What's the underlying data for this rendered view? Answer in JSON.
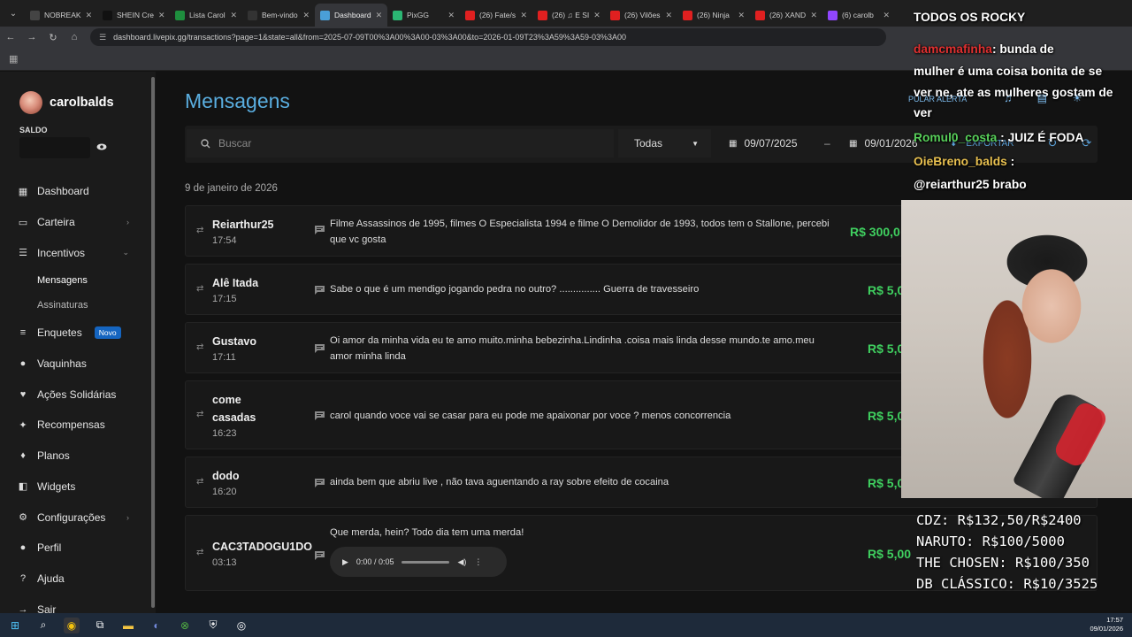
{
  "browser": {
    "tabs": [
      {
        "label": "NOBREAK",
        "color": "#444444"
      },
      {
        "label": "SHEIN Cre",
        "color": "#111111"
      },
      {
        "label": "Lista Carol",
        "color": "#1e8e3e"
      },
      {
        "label": "Bem-vindo",
        "color": "#333333"
      },
      {
        "label": "Dashboard",
        "color": "#4a9fd8",
        "active": true
      },
      {
        "label": "PixGG",
        "color": "#2bb673"
      },
      {
        "label": "(26) Fate/s",
        "color": "#e02020"
      },
      {
        "label": "(26) ♫ E SI",
        "color": "#e02020"
      },
      {
        "label": "(26) Vilões",
        "color": "#e02020"
      },
      {
        "label": "(26) Ninja",
        "color": "#e02020"
      },
      {
        "label": "(26) XAND",
        "color": "#e02020"
      },
      {
        "label": "(6) carolb",
        "color": "#9146ff"
      }
    ],
    "url": "dashboard.livepix.gg/transactions?page=1&state=all&from=2025-07-09T00%3A00%3A00-03%3A00&to=2026-01-09T23%3A59%3A59-03%3A00"
  },
  "sidebar": {
    "username": "carolbalds",
    "saldo_label": "SALDO",
    "items": [
      {
        "label": "Dashboard",
        "icon": "dashboard-icon",
        "glyph": "▦"
      },
      {
        "label": "Carteira",
        "icon": "wallet-icon",
        "glyph": "▭",
        "chevron": "›"
      },
      {
        "label": "Incentivos",
        "icon": "chat-icon",
        "glyph": "☰",
        "chevron": "⌄"
      },
      {
        "label": "Enquetes",
        "icon": "poll-icon",
        "glyph": "≡",
        "badge": "Novo"
      },
      {
        "label": "Vaquinhas",
        "icon": "piggy-icon",
        "glyph": "●"
      },
      {
        "label": "Ações Solidárias",
        "icon": "handshake-icon",
        "glyph": "♥"
      },
      {
        "label": "Recompensas",
        "icon": "gift-icon",
        "glyph": "✦"
      },
      {
        "label": "Planos",
        "icon": "plans-icon",
        "glyph": "♦"
      },
      {
        "label": "Widgets",
        "icon": "widgets-icon",
        "glyph": "◧"
      },
      {
        "label": "Configurações",
        "icon": "gear-icon",
        "glyph": "⚙",
        "chevron": "›"
      },
      {
        "label": "Perfil",
        "icon": "user-icon",
        "glyph": "●"
      },
      {
        "label": "Ajuda",
        "icon": "help-icon",
        "glyph": "?"
      },
      {
        "label": "Sair",
        "icon": "logout-icon",
        "glyph": "→"
      }
    ],
    "subitems": [
      "Mensagens",
      "Assinaturas"
    ]
  },
  "main": {
    "title": "Mensagens",
    "search_placeholder": "Buscar",
    "filter": "Todas",
    "date_from": "09/07/2025",
    "date_sep": "–",
    "date_to": "09/01/2026",
    "export_label": "EXPORTAR",
    "date_header": "9 de janeiro de 2026",
    "rows": [
      {
        "name": "Reiarthur25",
        "time": "17:54",
        "message": "Filme Assassinos de 1995, filmes O Especialista 1994 e filme O Demolidor de 1993, todos tem o Stallone, percebi que vc gosta",
        "amount": "R$ 300,0"
      },
      {
        "name": "Alê Itada",
        "time": "17:15",
        "message": "Sabe o que é um mendigo jogando pedra no outro? ............... Guerra de travesseiro",
        "amount": "R$ 5,0"
      },
      {
        "name": "Gustavo",
        "time": "17:11",
        "message": "Oi amor da minha vida eu te amo muito.minha bebezinha.Lindinha .coisa mais linda desse mundo.te amo.meu amor minha linda",
        "amount": "R$ 5,0"
      },
      {
        "name": "come casadas",
        "time": "16:23",
        "message": "carol quando voce vai se casar para eu pode me apaixonar por voce ? menos concorrencia",
        "amount": "R$ 5,0"
      },
      {
        "name": "dodo",
        "time": "16:20",
        "message": "ainda bem que abriu live , não tava aguentando a ray sobre efeito de cocaina",
        "amount": "R$ 5,0"
      },
      {
        "name": "CAC3TADOGU1DO",
        "time": "03:13",
        "message": "Que merda, hein? Todo dia tem uma merda!",
        "amount": "R$ 5,00",
        "audio": "0:00 / 0:05"
      }
    ]
  },
  "overlay": {
    "chat": [
      {
        "user": "",
        "text": "TODOS OS ROCKY"
      },
      {
        "user": "damcmafinha",
        "text": ": bunda de"
      },
      {
        "user": "",
        "text": "mulher é uma coisa bonita de se"
      },
      {
        "user": "",
        "text": "ver ne, ate as mulheres gostam de"
      },
      {
        "user": "",
        "text": "ver"
      },
      {
        "user": "Romul0_costa",
        "text": " : JUIZ É FODA"
      },
      {
        "user": "OieBreno_balds",
        "text": " :"
      },
      {
        "user": "",
        "text": "@reiarthur25 brabo"
      }
    ],
    "alert_label": "PULAR ALERTA",
    "goals": [
      "CDZ: R$132,50/R$2400",
      "NARUTO: R$100/5000",
      "THE CHOSEN: R$100/350",
      "DB CLÁSSICO: R$10/3525"
    ]
  },
  "taskbar": {
    "time": "17:57",
    "date": "09/01/2026"
  }
}
